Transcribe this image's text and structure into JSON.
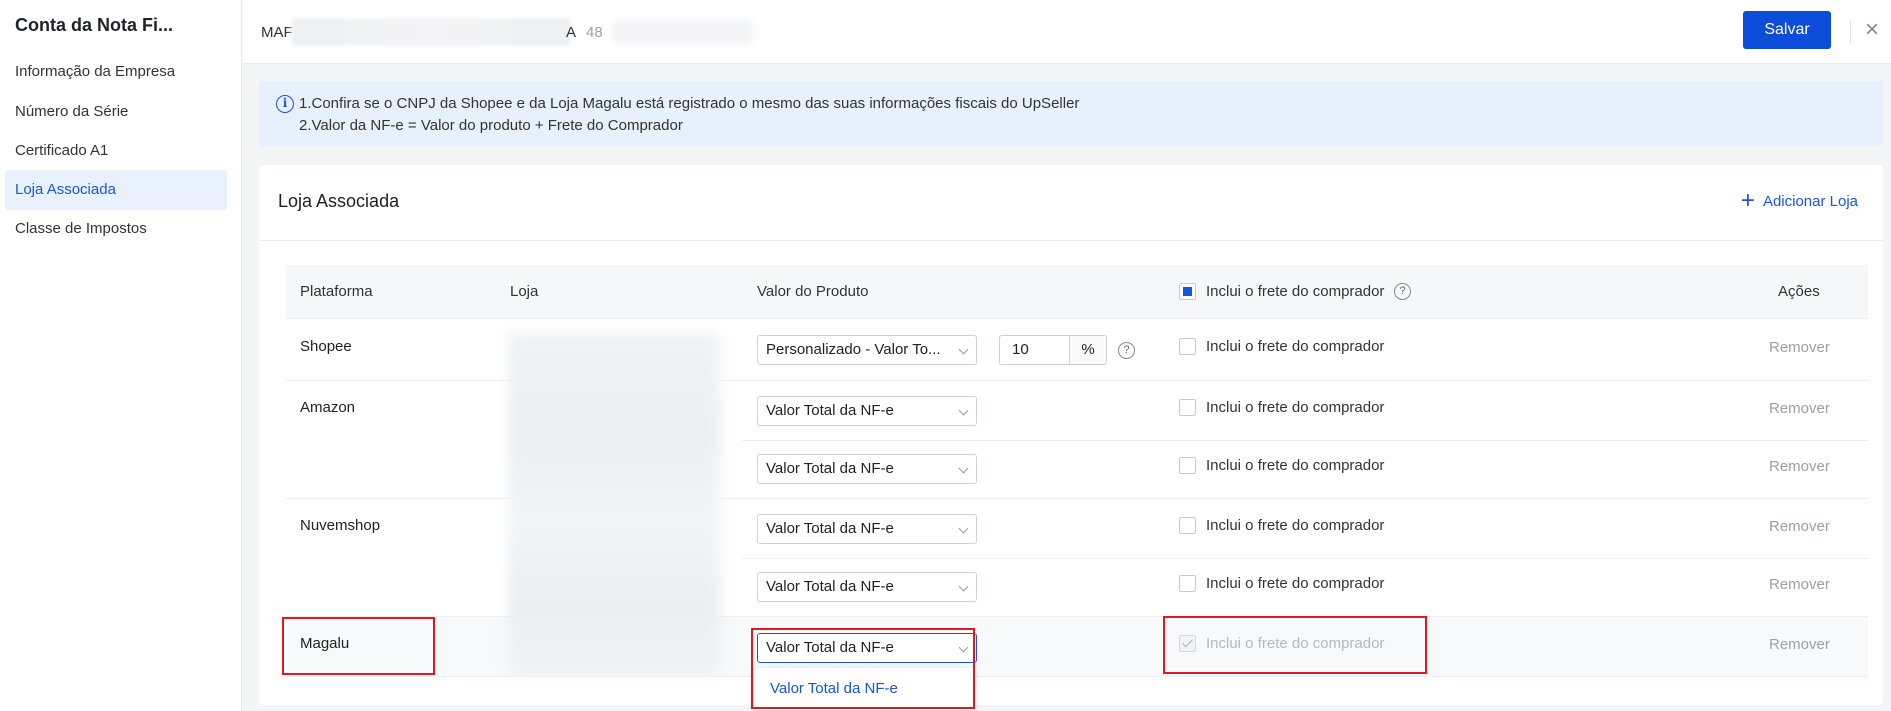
{
  "sidebar": {
    "title": "Conta da Nota Fi...",
    "items": [
      {
        "label": "Informação da Empresa"
      },
      {
        "label": "Número da Série"
      },
      {
        "label": "Certificado A1"
      },
      {
        "label": "Loja Associada"
      },
      {
        "label": "Classe de Impostos"
      }
    ]
  },
  "header": {
    "company_prefix": "MAF",
    "company_suffix": "A",
    "company_number": "48",
    "save_label": "Salvar",
    "close_symbol": "×"
  },
  "banner": {
    "line1": "1.Confira se o CNPJ da Shopee e da Loja Magalu está registrado o mesmo das suas informações fiscais do UpSeller",
    "line2": "2.Valor da NF-e = Valor do produto + Frete do Comprador"
  },
  "card": {
    "title": "Loja Associada",
    "add_store": "Adicionar Loja"
  },
  "table": {
    "headers": {
      "platform": "Plataforma",
      "store": "Loja",
      "product_value": "Valor do Produto",
      "freight": "Inclui o frete do comprador",
      "actions": "Ações"
    },
    "freight_label": "Inclui o frete do comprador",
    "remove_label": "Remover",
    "platforms": [
      "Shopee",
      "Amazon",
      "Nuvemshop",
      "Magalu"
    ],
    "selects": [
      "Personalizado - Valor To...",
      "Valor Total da NF-e",
      "Valor Total da NF-e",
      "Valor Total da NF-e",
      "Valor Total da NF-e",
      "Valor Total da NF-e"
    ],
    "percent_value": "10",
    "percent_symbol": "%"
  },
  "dropdown": {
    "option": "Valor Total da NF-e"
  },
  "colors": {
    "primary": "#0b4dd8",
    "link": "#1a56db",
    "annotation": "#e0181f"
  }
}
